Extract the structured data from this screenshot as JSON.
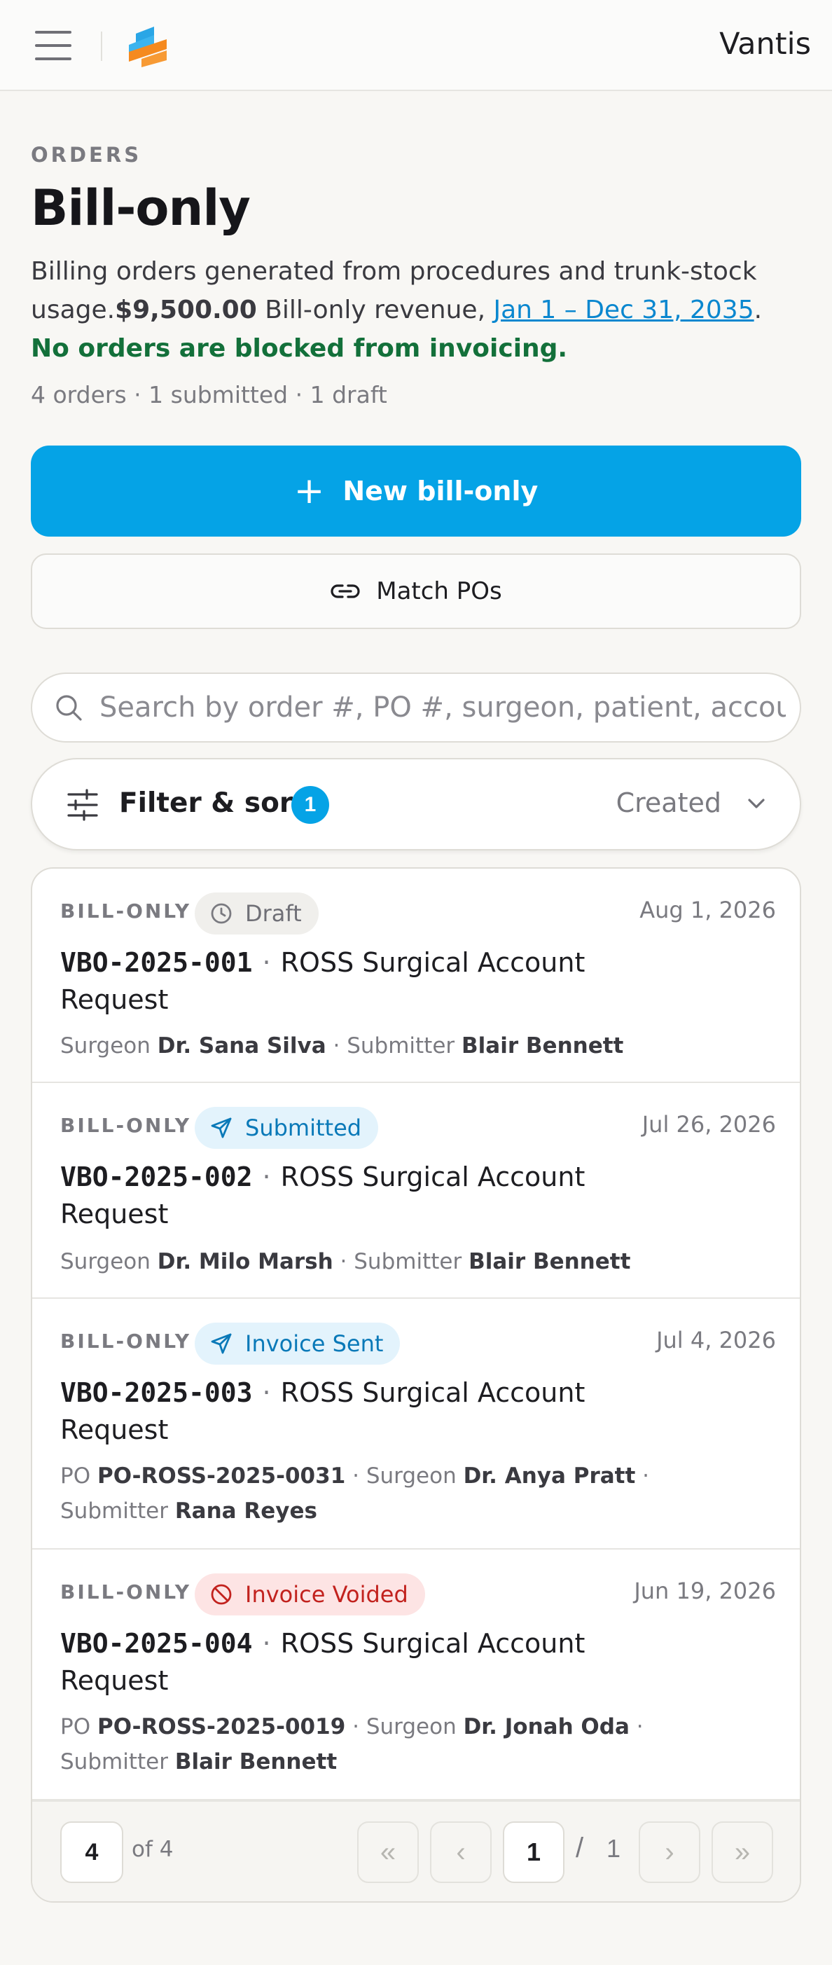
{
  "header": {
    "brand": "Vantis",
    "colors": {
      "logo_top": "#2aa6e6",
      "logo_bottom": "#f58a1f"
    }
  },
  "page": {
    "eyebrow": "ORDERS",
    "title": "Bill-only",
    "desc_prefix": "Billing orders generated from procedures and trunk-stock usage.",
    "desc_amount": "$9,500.00",
    "desc_mid": " Bill-only revenue, ",
    "desc_range": "Jan 1 – Dec 31, 2035",
    "desc_period": ".",
    "desc_status": "No orders are blocked from invoicing.",
    "meta": "4 orders · 1 submitted · 1 draft"
  },
  "actions": {
    "new_label": "New bill-only",
    "match_label": "Match POs"
  },
  "search": {
    "placeholder": "Search by order #, PO #, surgeon, patient, account..."
  },
  "filter": {
    "label": "Filter & sort",
    "count": "1",
    "sort_value": "Created"
  },
  "orders": [
    {
      "type": "BILL-ONLY",
      "status": "Draft",
      "status_icon": "clock-icon",
      "date": "Aug 1, 2026",
      "number": "VBO-2025-001",
      "account": "ROSS Surgical Account Request",
      "po_label": "",
      "po": "",
      "surgeon_label": "Surgeon",
      "surgeon": "Dr. Sana Silva",
      "submitter_label": "Submitter",
      "submitter": "Blair Bennett"
    },
    {
      "type": "BILL-ONLY",
      "status": "Submitted",
      "status_icon": "send-icon",
      "date": "Jul 26, 2026",
      "number": "VBO-2025-002",
      "account": "ROSS Surgical Account Request",
      "po_label": "",
      "po": "",
      "surgeon_label": "Surgeon",
      "surgeon": "Dr. Milo Marsh",
      "submitter_label": "Submitter",
      "submitter": "Blair Bennett"
    },
    {
      "type": "BILL-ONLY",
      "status": "Invoice Sent",
      "status_icon": "send-icon",
      "date": "Jul 4, 2026",
      "number": "VBO-2025-003",
      "account": "ROSS Surgical Account Request",
      "po_label": "PO",
      "po": "PO-ROSS-2025-0031",
      "surgeon_label": "Surgeon",
      "surgeon": "Dr. Anya Pratt",
      "submitter_label": "Submitter",
      "submitter": "Rana Reyes"
    },
    {
      "type": "BILL-ONLY",
      "status": "Invoice Voided",
      "status_icon": "ban-icon",
      "date": "Jun 19, 2026",
      "number": "VBO-2025-004",
      "account": "ROSS Surgical Account Request",
      "po_label": "PO",
      "po": "PO-ROSS-2025-0019",
      "surgeon_label": "Surgeon",
      "surgeon": "Dr. Jonah Oda",
      "submitter_label": "Submitter",
      "submitter": "Blair Bennett"
    }
  ],
  "pagination": {
    "page_size": "4",
    "of_total": "of 4",
    "current_page": "1",
    "separator": "/",
    "total_pages": "1",
    "first_glyph": "«",
    "prev_glyph": "‹",
    "next_glyph": "›",
    "last_glyph": "»"
  }
}
